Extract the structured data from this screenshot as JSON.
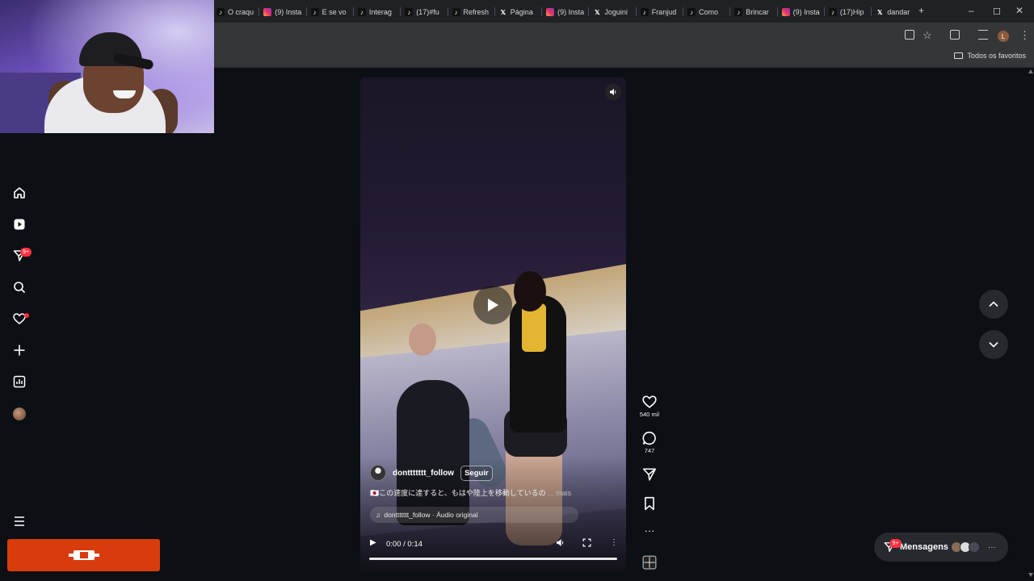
{
  "browser": {
    "tabs": [
      {
        "icon": "tiktok",
        "label": "O craqu"
      },
      {
        "icon": "instagram",
        "label": "(9) Insta"
      },
      {
        "icon": "tiktok",
        "label": "E se vo"
      },
      {
        "icon": "tiktok",
        "label": "Interag"
      },
      {
        "icon": "tiktok",
        "label": "(17)#fu"
      },
      {
        "icon": "tiktok",
        "label": "Refresh"
      },
      {
        "icon": "x",
        "label": "Página"
      },
      {
        "icon": "instagram",
        "label": "(9) Insta"
      },
      {
        "icon": "x",
        "label": "Joguini"
      },
      {
        "icon": "tiktok",
        "label": "Franjud"
      },
      {
        "icon": "tiktok",
        "label": "Como"
      },
      {
        "icon": "tiktok",
        "label": "Brincar"
      },
      {
        "icon": "instagram",
        "label": "(9) Insta"
      },
      {
        "icon": "tiktok",
        "label": "(17)Hip"
      },
      {
        "icon": "x",
        "label": "dandar"
      }
    ],
    "new_tab": "+",
    "bookmarks_folder": "Todos os favoritos",
    "profile_initial": "L"
  },
  "sidebar": {
    "items": [
      "home-icon",
      "reels-icon",
      "explore-icon",
      "search-icon",
      "notifications-icon",
      "create-icon",
      "dashboard-icon",
      "profile-icon"
    ],
    "direct_badge": "9+",
    "menu": "More"
  },
  "post": {
    "author": "donttttttt_follow",
    "follow_label": "Seguir",
    "caption": "🇯🇵この速度に達すると、もはや陸上を移動しているの",
    "caption_more": "... mais",
    "audio": "donttttttt_follow · Áudio original",
    "time": "0:00 / 0:14",
    "progress": 0
  },
  "actions": {
    "likes": "540 mil",
    "comments": "747"
  },
  "messages": {
    "label": "Mensagens",
    "badge": "9+"
  },
  "colors": {
    "background": "#0c1014",
    "badge": "#ff3040",
    "banner": "#d83c0c"
  }
}
